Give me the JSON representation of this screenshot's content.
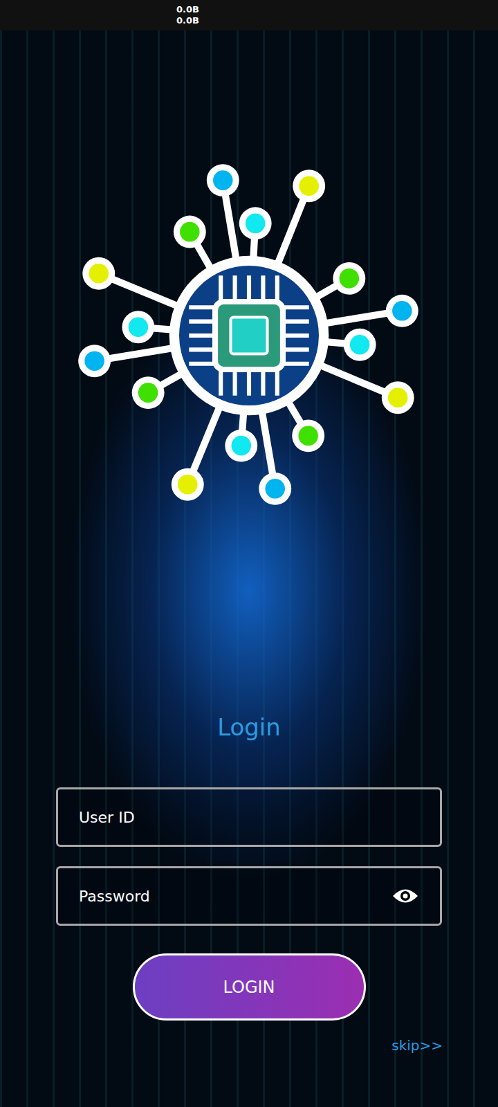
{
  "status_bar": {
    "upload": "0.0B",
    "download": "0.0B"
  },
  "title": "Login",
  "fields": [
    {
      "placeholder": "User ID",
      "kind": "text"
    },
    {
      "placeholder": "Password",
      "kind": "password"
    }
  ],
  "buttons": {
    "login": "LOGIN",
    "skip": "skip>>"
  }
}
